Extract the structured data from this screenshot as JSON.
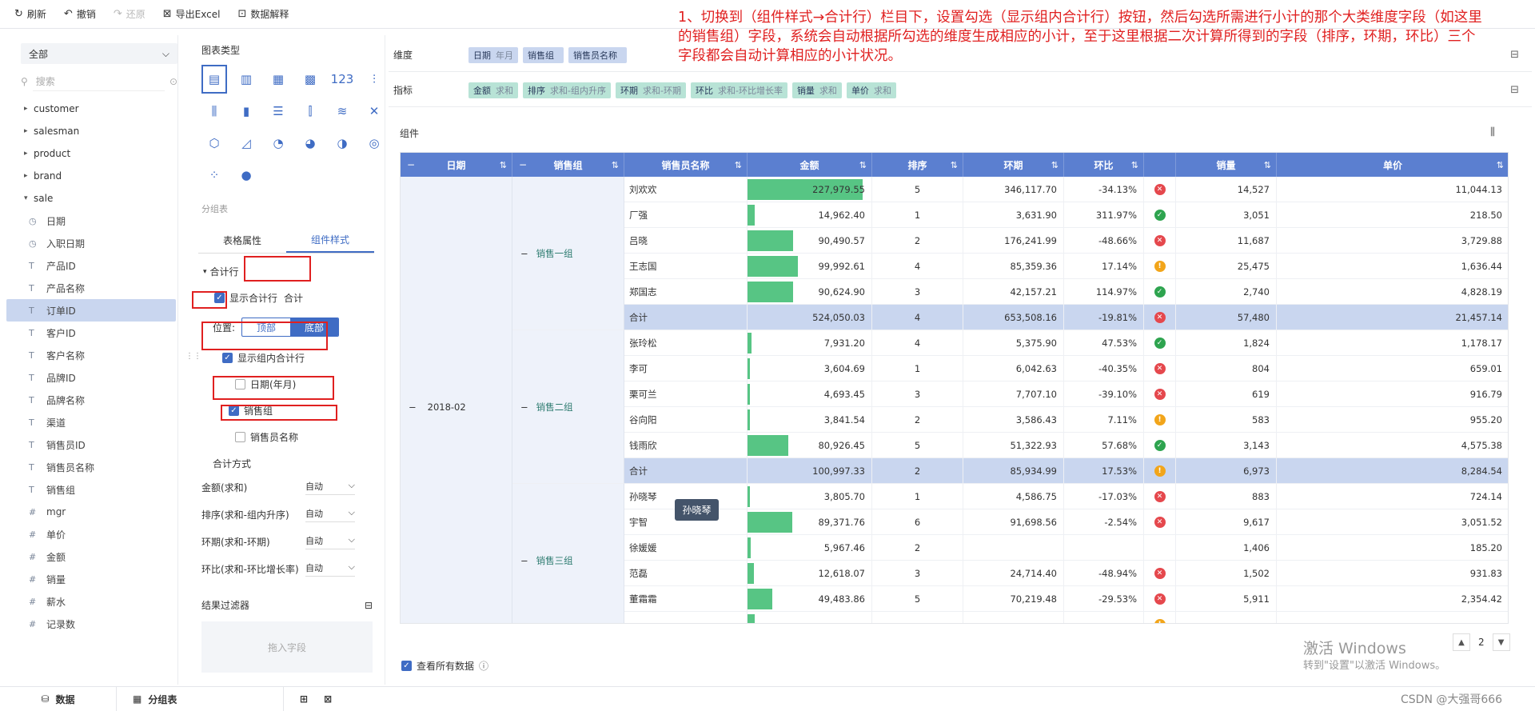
{
  "toolbar": {
    "refresh": "刷新",
    "undo": "撤销",
    "redo": "还原",
    "export": "导出Excel",
    "explain": "数据解释"
  },
  "sidebar": {
    "dataset": "全部",
    "search_placeholder": "搜索",
    "tables": [
      "customer",
      "salesman",
      "product",
      "brand",
      "sale"
    ],
    "fields": [
      {
        "icon": "clock-icon",
        "glyph": "◷",
        "name": "日期"
      },
      {
        "icon": "clock-icon",
        "glyph": "◷",
        "name": "入职日期"
      },
      {
        "icon": "text-icon",
        "glyph": "T",
        "name": "产品ID"
      },
      {
        "icon": "text-icon",
        "glyph": "T",
        "name": "产品名称"
      },
      {
        "icon": "text-icon",
        "glyph": "T",
        "name": "订单ID"
      },
      {
        "icon": "text-icon",
        "glyph": "T",
        "name": "客户ID"
      },
      {
        "icon": "text-icon",
        "glyph": "T",
        "name": "客户名称"
      },
      {
        "icon": "text-icon",
        "glyph": "T",
        "name": "品牌ID"
      },
      {
        "icon": "text-icon",
        "glyph": "T",
        "name": "品牌名称"
      },
      {
        "icon": "text-icon",
        "glyph": "T",
        "name": "渠道"
      },
      {
        "icon": "text-icon",
        "glyph": "T",
        "name": "销售员ID"
      },
      {
        "icon": "text-icon",
        "glyph": "T",
        "name": "销售员名称"
      },
      {
        "icon": "text-icon",
        "glyph": "T",
        "name": "销售组"
      },
      {
        "icon": "hash-icon",
        "glyph": "#",
        "name": "mgr"
      },
      {
        "icon": "hash-icon",
        "glyph": "#",
        "name": "单价"
      },
      {
        "icon": "hash-icon",
        "glyph": "#",
        "name": "金额"
      },
      {
        "icon": "hash-icon",
        "glyph": "#",
        "name": "销量"
      },
      {
        "icon": "hash-icon",
        "glyph": "#",
        "name": "薪水"
      },
      {
        "icon": "hash-icon",
        "glyph": "#",
        "name": "记录数"
      }
    ]
  },
  "panel": {
    "chart_type": "图表类型",
    "group_table": "分组表",
    "tab_props": "表格属性",
    "tab_style": "组件样式",
    "section": "合计行",
    "show_total": "显示合计行",
    "total_label": "合计",
    "position": "位置:",
    "pos_top": "顶部",
    "pos_bottom": "底部",
    "show_group_total": "显示组内合计行",
    "dims": [
      {
        "label": "日期(年月)",
        "checked": false
      },
      {
        "label": "销售组",
        "checked": true
      },
      {
        "label": "销售员名称",
        "checked": false
      }
    ],
    "agg_title": "合计方式",
    "aggs": [
      {
        "k": "金额(求和)",
        "v": "自动"
      },
      {
        "k": "排序(求和-组内升序)",
        "v": "自动"
      },
      {
        "k": "环期(求和-环期)",
        "v": "自动"
      },
      {
        "k": "环比(求和-环比增长率)",
        "v": "自动"
      }
    ],
    "filter_title": "结果过滤器",
    "filter_drop": "拖入字段"
  },
  "dimbar": {
    "label": "维度",
    "items": [
      {
        "name": "日期",
        "meta": "年月"
      },
      {
        "name": "销售组",
        "meta": ""
      },
      {
        "name": "销售员名称",
        "meta": ""
      }
    ]
  },
  "idxbar": {
    "label": "指标",
    "items": [
      {
        "name": "金额",
        "meta": "求和"
      },
      {
        "name": "排序",
        "meta": "求和-组内升序"
      },
      {
        "name": "环期",
        "meta": "求和-环期"
      },
      {
        "name": "环比",
        "meta": "求和-环比增长率"
      },
      {
        "name": "销量",
        "meta": "求和"
      },
      {
        "name": "单价",
        "meta": "求和"
      }
    ]
  },
  "note": "1、切换到（组件样式→合计行）栏目下，设置勾选（显示组内合计行）按钮，然后勾选所需进行小计的那个大类维度字段（如这里的销售组）字段，系统会自动根据所勾选的维度生成相应的小计，至于这里根据二次计算所得到的字段（排序，环期，环比）三个字段都会自动计算相应的小计状况。",
  "component_title": "组件",
  "table": {
    "headers": [
      "日期",
      "销售组",
      "销售员名称",
      "金额",
      "排序",
      "环期",
      "环比",
      "",
      "销量",
      "单价"
    ],
    "date": "2018-02",
    "groups": [
      {
        "name": "销售一组",
        "rows": [
          {
            "n": "刘欢欢",
            "amt": "227,979.55",
            "v": 227979.55,
            "rank": "5",
            "prev": "346,117.70",
            "mom": "-34.13%",
            "st": "bad",
            "qty": "14,527",
            "price": "11,044.13"
          },
          {
            "n": "厂强",
            "amt": "14,962.40",
            "v": 14962.4,
            "rank": "1",
            "prev": "3,631.90",
            "mom": "311.97%",
            "st": "ok",
            "qty": "3,051",
            "price": "218.50"
          },
          {
            "n": "吕晓",
            "amt": "90,490.57",
            "v": 90490.57,
            "rank": "2",
            "prev": "176,241.99",
            "mom": "-48.66%",
            "st": "bad",
            "qty": "11,687",
            "price": "3,729.88"
          },
          {
            "n": "王志国",
            "amt": "99,992.61",
            "v": 99992.61,
            "rank": "4",
            "prev": "85,359.36",
            "mom": "17.14%",
            "st": "warn",
            "qty": "25,475",
            "price": "1,636.44"
          },
          {
            "n": "郑国志",
            "amt": "90,624.90",
            "v": 90624.9,
            "rank": "3",
            "prev": "42,157.21",
            "mom": "114.97%",
            "st": "ok",
            "qty": "2,740",
            "price": "4,828.19"
          }
        ],
        "total": {
          "n": "合计",
          "amt": "524,050.03",
          "rank": "4",
          "prev": "653,508.16",
          "mom": "-19.81%",
          "st": "bad",
          "qty": "57,480",
          "price": "21,457.14"
        }
      },
      {
        "name": "销售二组",
        "rows": [
          {
            "n": "张玲松",
            "amt": "7,931.20",
            "v": 7931.2,
            "rank": "4",
            "prev": "5,375.90",
            "mom": "47.53%",
            "st": "ok",
            "qty": "1,824",
            "price": "1,178.17"
          },
          {
            "n": "李可",
            "amt": "3,604.69",
            "v": 3604.69,
            "rank": "1",
            "prev": "6,042.63",
            "mom": "-40.35%",
            "st": "bad",
            "qty": "804",
            "price": "659.01"
          },
          {
            "n": "栗可兰",
            "amt": "4,693.45",
            "v": 4693.45,
            "rank": "3",
            "prev": "7,707.10",
            "mom": "-39.10%",
            "st": "bad",
            "qty": "619",
            "price": "916.79"
          },
          {
            "n": "谷向阳",
            "amt": "3,841.54",
            "v": 3841.54,
            "rank": "2",
            "prev": "3,586.43",
            "mom": "7.11%",
            "st": "warn",
            "qty": "583",
            "price": "955.20"
          },
          {
            "n": "钱雨欣",
            "amt": "80,926.45",
            "v": 80926.45,
            "rank": "5",
            "prev": "51,322.93",
            "mom": "57.68%",
            "st": "ok",
            "qty": "3,143",
            "price": "4,575.38"
          }
        ],
        "total": {
          "n": "合计",
          "amt": "100,997.33",
          "rank": "2",
          "prev": "85,934.99",
          "mom": "17.53%",
          "st": "warn",
          "qty": "6,973",
          "price": "8,284.54"
        }
      },
      {
        "name": "销售三组",
        "rows": [
          {
            "n": "孙晓琴",
            "amt": "3,805.70",
            "v": 3805.7,
            "rank": "1",
            "prev": "4,586.75",
            "mom": "-17.03%",
            "st": "bad",
            "qty": "883",
            "price": "724.14"
          },
          {
            "n": "宇智",
            "amt": "89,371.76",
            "v": 89371.76,
            "rank": "6",
            "prev": "91,698.56",
            "mom": "-2.54%",
            "st": "bad",
            "qty": "9,617",
            "price": "3,051.52"
          },
          {
            "n": "徐媛媛",
            "amt": "5,967.46",
            "v": 5967.46,
            "rank": "2",
            "prev": "",
            "mom": "",
            "st": "",
            "qty": "1,406",
            "price": "185.20"
          },
          {
            "n": "范磊",
            "amt": "12,618.07",
            "v": 12618.07,
            "rank": "3",
            "prev": "24,714.40",
            "mom": "-48.94%",
            "st": "bad",
            "qty": "1,502",
            "price": "931.83"
          },
          {
            "n": "董霜霜",
            "amt": "49,483.86",
            "v": 49483.86,
            "rank": "5",
            "prev": "70,219.48",
            "mom": "-29.53%",
            "st": "bad",
            "qty": "5,911",
            "price": "2,354.42"
          },
          {
            "n": "",
            "amt": "",
            "v": 14000,
            "rank": "",
            "prev": "",
            "mom": "",
            "st": "warn",
            "qty": "",
            "price": ""
          }
        ]
      }
    ],
    "max": 227979.55
  },
  "tooltip": "孙晓琴",
  "footer": {
    "view_all": "查看所有数据",
    "page": "2"
  },
  "bottom": {
    "data_tab": "数据",
    "group_tab": "分组表"
  },
  "watermark": {
    "line1": "激活 Windows",
    "line2": "转到\"设置\"以激活 Windows。"
  },
  "csdn": "CSDN @大强哥666"
}
